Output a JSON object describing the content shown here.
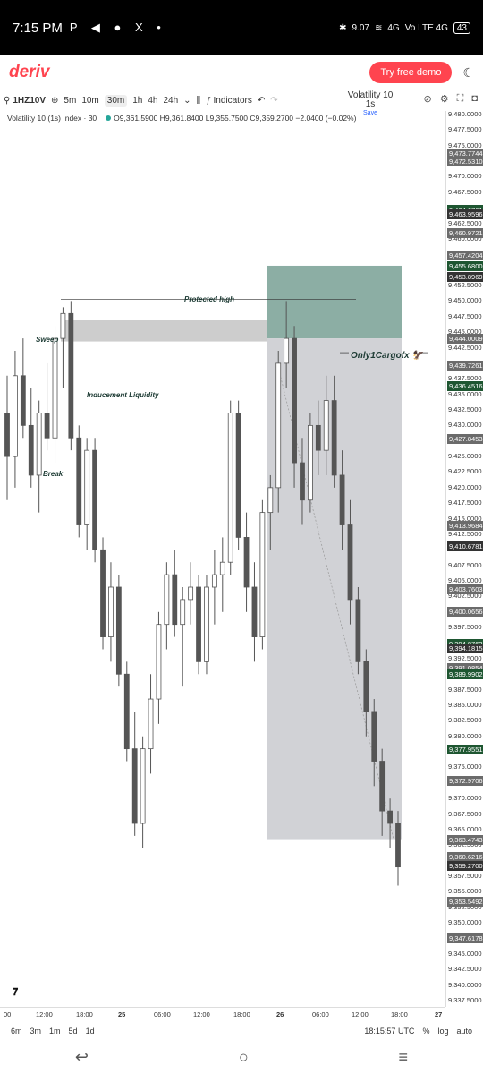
{
  "status": {
    "time": "7:15 PM",
    "apps": "P ◀ ● X •",
    "speed": "9.07",
    "signal": "4G",
    "network": "Vo LTE 4G",
    "battery": "43"
  },
  "header": {
    "logo": "deriv",
    "demo_button": "Try free demo"
  },
  "toolbar": {
    "symbol": "1HZ10V",
    "intervals": [
      "5m",
      "10m",
      "30m",
      "1h",
      "4h",
      "24h"
    ],
    "active_interval": "30m",
    "indicators": "Indicators",
    "layout_name": "Volatility 10 1s",
    "save": "Save"
  },
  "legend": {
    "title": "Volatility 10 (1s) Index · 30",
    "ohlc": "O9,361.5900 H9,361.8400 L9,355.7500 C9,359.2700 −2.0400 (−0.02%)"
  },
  "annotations": {
    "protected_high": "Protected high",
    "sweep": "Sweep",
    "inducement": "Inducement Liquidity",
    "break": "Break",
    "watermark": "Only1Cargofx 🦅"
  },
  "colors": {
    "brand": "#ff444f",
    "green_tag": "#1e5631",
    "gray_tag": "#6b6b6b",
    "dark_tag": "#333333",
    "zone_target": "#7fa59a",
    "zone_risk": "#c9cacf"
  },
  "price_axis": {
    "min": 9337.5,
    "max": 9480.0,
    "labels": [
      "9,480.0000",
      "9,477.5000",
      "9,475.0000",
      "9,470.0000",
      "9,467.5000",
      "9,462.5000",
      "9,460.0000",
      "9,452.5000",
      "9,450.0000",
      "9,447.5000",
      "9,445.0000",
      "9,442.5000",
      "9,437.5000",
      "9,435.0000",
      "9,432.5000",
      "9,430.0000",
      "9,425.0000",
      "9,422.5000",
      "9,420.0000",
      "9,417.5000",
      "9,415.0000",
      "9,412.5000",
      "9,407.5000",
      "9,405.0000",
      "9,402.5000",
      "9,397.5000",
      "9,392.5000",
      "9,387.5000",
      "9,385.0000",
      "9,382.5000",
      "9,380.0000",
      "9,375.0000",
      "9,370.0000",
      "9,367.5000",
      "9,365.0000",
      "9,362.5000",
      "9,357.5000",
      "9,355.0000",
      "9,352.5000",
      "9,350.0000",
      "9,345.0000",
      "9,342.5000",
      "9,340.0000",
      "9,337.5000"
    ],
    "tags": [
      {
        "text": "9,473.7744",
        "v": 9473.7744,
        "c": "gray"
      },
      {
        "text": "9,472.5310",
        "v": 9472.531,
        "c": "gray"
      },
      {
        "text": "9,464.6761",
        "v": 9464.6761,
        "c": "green"
      },
      {
        "text": "9,463.9596",
        "v": 9463.9596,
        "c": "dark"
      },
      {
        "text": "9,460.9721",
        "v": 9460.9721,
        "c": "gray"
      },
      {
        "text": "9,457.4204",
        "v": 9457.4204,
        "c": "gray"
      },
      {
        "text": "9,455.6800",
        "v": 9455.68,
        "c": "green"
      },
      {
        "text": "9,453.8969",
        "v": 9453.8969,
        "c": "dark"
      },
      {
        "text": "9,444.0009",
        "v": 9444.0009,
        "c": "gray"
      },
      {
        "text": "9,439.7261",
        "v": 9439.7261,
        "c": "gray"
      },
      {
        "text": "9,436.4516",
        "v": 9436.4516,
        "c": "green"
      },
      {
        "text": "9,427.8453",
        "v": 9427.8453,
        "c": "gray"
      },
      {
        "text": "9,413.9684",
        "v": 9413.9684,
        "c": "gray"
      },
      {
        "text": "9,410.6781",
        "v": 9410.6781,
        "c": "dark"
      },
      {
        "text": "9,403.7603",
        "v": 9403.7603,
        "c": "gray"
      },
      {
        "text": "9,400.0656",
        "v": 9400.0656,
        "c": "gray"
      },
      {
        "text": "9,394.8763",
        "v": 9394.8763,
        "c": "green"
      },
      {
        "text": "9,394.1815",
        "v": 9394.1815,
        "c": "dark"
      },
      {
        "text": "9,391.0854",
        "v": 9391.0854,
        "c": "gray"
      },
      {
        "text": "9,389.9902",
        "v": 9389.9902,
        "c": "green"
      },
      {
        "text": "9,377.9551",
        "v": 9377.9551,
        "c": "green"
      },
      {
        "text": "9,372.9706",
        "v": 9372.9706,
        "c": "gray"
      },
      {
        "text": "9,363.4743",
        "v": 9363.4743,
        "c": "gray"
      },
      {
        "text": "9,360.6216",
        "v": 9360.6216,
        "c": "gray"
      },
      {
        "text": "9,359.2700",
        "v": 9359.27,
        "c": "dark"
      },
      {
        "text": "9,353.5492",
        "v": 9353.5492,
        "c": "gray"
      },
      {
        "text": "9,347.6178",
        "v": 9347.6178,
        "c": "gray"
      }
    ]
  },
  "time_axis": [
    "00",
    "12:00",
    "18:00",
    "25",
    "06:00",
    "12:00",
    "18:00",
    "26",
    "06:00",
    "12:00",
    "18:00",
    "27"
  ],
  "bottom": {
    "ranges": [
      "6m",
      "3m",
      "1m",
      "5d",
      "1d"
    ],
    "utc": "18:15:57 UTC",
    "percent": "%",
    "log": "log",
    "auto": "auto"
  },
  "candles": [
    [
      9432,
      9438,
      9418,
      9425
    ],
    [
      9425,
      9442,
      9420,
      9438
    ],
    [
      9438,
      9444,
      9428,
      9430
    ],
    [
      9430,
      9436,
      9420,
      9422
    ],
    [
      9422,
      9434,
      9416,
      9432
    ],
    [
      9432,
      9440,
      9426,
      9428
    ],
    [
      9428,
      9446,
      9424,
      9444
    ],
    [
      9444,
      9449,
      9436,
      9448
    ],
    [
      9448,
      9450,
      9426,
      9428
    ],
    [
      9428,
      9430,
      9412,
      9414
    ],
    [
      9414,
      9428,
      9410,
      9426
    ],
    [
      9426,
      9428,
      9408,
      9410
    ],
    [
      9410,
      9412,
      9394,
      9396
    ],
    [
      9396,
      9408,
      9392,
      9404
    ],
    [
      9404,
      9406,
      9388,
      9390
    ],
    [
      9390,
      9392,
      9376,
      9378
    ],
    [
      9378,
      9384,
      9364,
      9366
    ],
    [
      9366,
      9380,
      9362,
      9378
    ],
    [
      9378,
      9390,
      9374,
      9386
    ],
    [
      9386,
      9400,
      9382,
      9398
    ],
    [
      9398,
      9408,
      9394,
      9406
    ],
    [
      9406,
      9410,
      9396,
      9398
    ],
    [
      9398,
      9404,
      9388,
      9402
    ],
    [
      9402,
      9408,
      9398,
      9404
    ],
    [
      9404,
      9406,
      9390,
      9392
    ],
    [
      9392,
      9406,
      9390,
      9404
    ],
    [
      9404,
      9410,
      9398,
      9406
    ],
    [
      9406,
      9412,
      9400,
      9408
    ],
    [
      9408,
      9434,
      9406,
      9432
    ],
    [
      9432,
      9434,
      9410,
      9412
    ],
    [
      9412,
      9416,
      9400,
      9404
    ],
    [
      9404,
      9408,
      9392,
      9396
    ],
    [
      9396,
      9418,
      9394,
      9416
    ],
    [
      9416,
      9422,
      9410,
      9420
    ],
    [
      9420,
      9442,
      9416,
      9440
    ],
    [
      9440,
      9450,
      9436,
      9444
    ],
    [
      9444,
      9446,
      9420,
      9424
    ],
    [
      9424,
      9428,
      9414,
      9418
    ],
    [
      9418,
      9432,
      9416,
      9430
    ],
    [
      9430,
      9434,
      9422,
      9426
    ],
    [
      9426,
      9438,
      9422,
      9434
    ],
    [
      9434,
      9438,
      9420,
      9422
    ],
    [
      9422,
      9426,
      9410,
      9414
    ],
    [
      9414,
      9418,
      9398,
      9402
    ],
    [
      9402,
      9404,
      9390,
      9392
    ],
    [
      9392,
      9394,
      9380,
      9384
    ],
    [
      9384,
      9386,
      9372,
      9376
    ],
    [
      9376,
      9378,
      9364,
      9368
    ],
    [
      9368,
      9370,
      9362,
      9366
    ],
    [
      9366,
      9368,
      9356,
      9359
    ]
  ]
}
